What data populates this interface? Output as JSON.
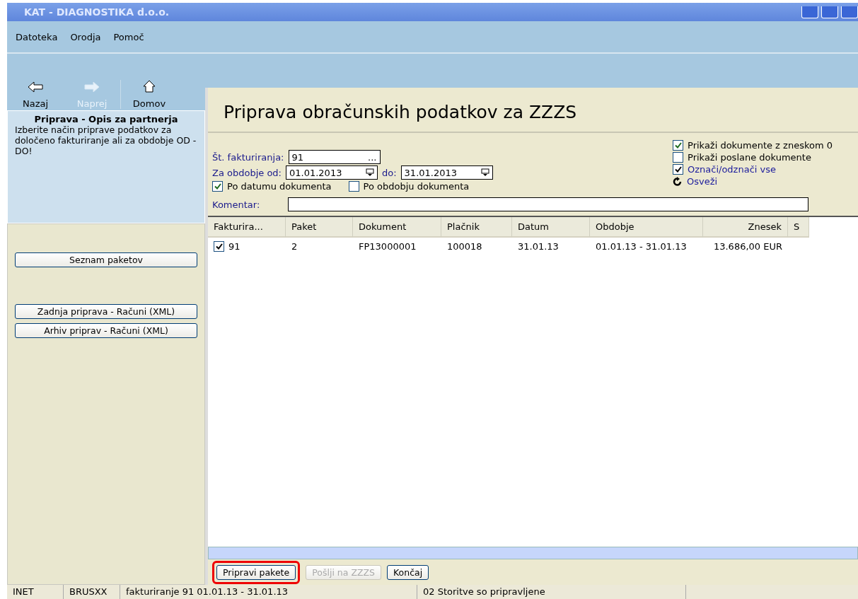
{
  "window": {
    "title": "KAT - DIAGNOSTIKA d.o.o."
  },
  "menu": [
    "Datoteka",
    "Orodja",
    "Pomoč"
  ],
  "toolbar": [
    {
      "kind": "back",
      "label": "Nazaj",
      "disabled": false
    },
    {
      "kind": "forward",
      "label": "Naprej",
      "disabled": true
    },
    {
      "kind": "home",
      "label": "Domov",
      "disabled": false
    }
  ],
  "sidebar": {
    "title": "Priprava - Opis za partnerja",
    "description": "Izberite način priprave podatkov za določeno fakturiranje ali za obdobje OD - DO!",
    "buttons": [
      "Seznam paketov",
      "Zadnja priprava - Računi (XML)",
      "Arhiv priprav - Računi (XML)"
    ]
  },
  "page_title": "Priprava obračunskih podatkov za ZZZS",
  "form": {
    "invoice_label": "Št. fakturiranja:",
    "invoice_value": "91",
    "invoice_button": "...",
    "period_label": "Za obdobje od:",
    "date_from": "01.01.2013",
    "to_label": "do:",
    "date_to": "31.01.2013",
    "options": [
      {
        "label": "Po datumu dokumenta",
        "checked": true
      },
      {
        "label": "Po obdobju dokumenta",
        "checked": false
      }
    ],
    "right_options": [
      {
        "kind": "checkbox",
        "label": "Prikaži dokumente z zneskom 0",
        "checked": true
      },
      {
        "kind": "checkbox",
        "label": "Prikaži poslane dokumente",
        "checked": false
      },
      {
        "kind": "link-checkbox",
        "label": "Označi/odznači vse",
        "checked": true
      },
      {
        "kind": "refresh",
        "label": "Osveži"
      }
    ],
    "comment_label": "Komentar:"
  },
  "table": {
    "columns": [
      "Fakturira...",
      "Paket",
      "Dokument",
      "Plačnik",
      "Datum",
      "Obdobje",
      "Znesek",
      "S"
    ],
    "rows": [
      {
        "checked": true,
        "cells": [
          "91",
          "2",
          "FP13000001",
          "100018",
          "31.01.13",
          "01.01.13 - 31.01.13",
          "13.686,00 EUR"
        ]
      }
    ]
  },
  "actions": [
    {
      "label": "Pripravi pakete",
      "disabled": false,
      "highlighted": true
    },
    {
      "label": "Pošlji na ZZZS",
      "disabled": true,
      "highlighted": false
    },
    {
      "label": "Končaj",
      "disabled": false,
      "highlighted": false
    }
  ],
  "status_bar": [
    "INET",
    "BRUSXX",
    "fakturiranje 91  01.01.13 - 31.01.13",
    "02 Storitve so pripravljene"
  ]
}
